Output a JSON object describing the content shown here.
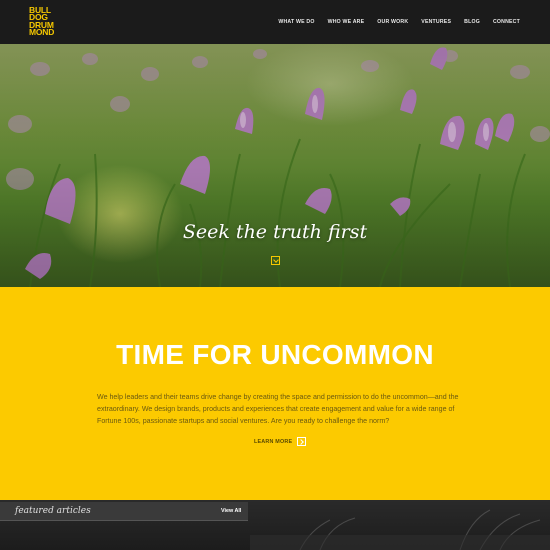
{
  "header": {
    "logo_lines": [
      "BULL",
      "DOG",
      "DRUM",
      "MOND"
    ],
    "nav": [
      "WHAT WE DO",
      "WHO WE ARE",
      "OUR WORK",
      "VENTURES",
      "BLOG",
      "CONNECT"
    ]
  },
  "hero": {
    "tagline": "Seek the truth first",
    "down_icon": "chevron-down-icon"
  },
  "intro": {
    "title": "TIME FOR UNCOMMON",
    "body": "We help leaders and their teams drive change by creating the space and permission to do the uncommon—and the extraordinary. We design brands, products and experiences that create engagement and value for a wide range of Fortune 100s, passionate startups and social ventures. Are you ready to challenge the norm?",
    "cta_label": "LEARN MORE",
    "cta_icon": "chevron-right-icon"
  },
  "featured": {
    "label": "featured articles",
    "view_all": "View All"
  },
  "colors": {
    "brand_yellow": "#fcca00",
    "header_bg": "#1b1b1b"
  }
}
